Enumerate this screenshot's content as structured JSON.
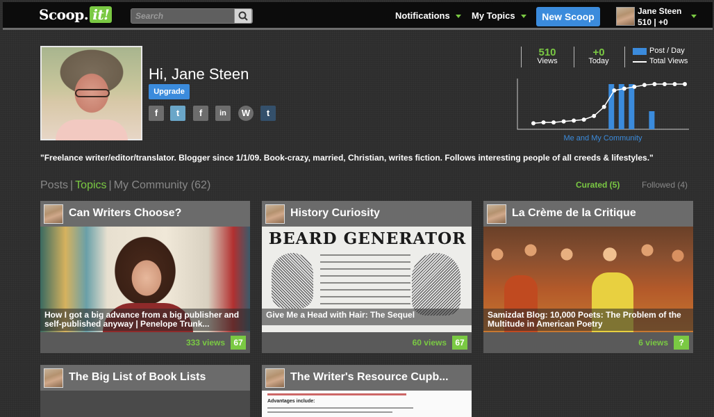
{
  "topbar": {
    "logo_main": "Scoop.",
    "logo_it": "it!",
    "search_placeholder": "Search",
    "notifications": "Notifications",
    "my_topics": "My Topics",
    "new_scoop": "New Scoop",
    "user_name": "Jane Steen",
    "user_stats": "510 | +0"
  },
  "profile": {
    "greeting": "Hi, Jane Steen",
    "upgrade": "Upgrade",
    "social": [
      {
        "name": "facebook",
        "glyph": "f",
        "color": "#6d6d6d"
      },
      {
        "name": "twitter",
        "glyph": "t",
        "color": "#6aa6c8"
      },
      {
        "name": "facebook-page",
        "glyph": "f",
        "color": "#6d6d6d"
      },
      {
        "name": "linkedin",
        "glyph": "in",
        "color": "#6d6d6d"
      },
      {
        "name": "wordpress",
        "glyph": "W",
        "color": "#6d6d6d"
      },
      {
        "name": "tumblr",
        "glyph": "t",
        "color": "#34506b"
      }
    ],
    "bio": "\"Freelance writer/editor/translator. Blogger since 1/1/09. Book-crazy, married, Christian, writes fiction. Follows interesting people of all creeds & lifestyles.\""
  },
  "stats": {
    "views_num": "510",
    "views_label": "Views",
    "today_num": "+0",
    "today_label": "Today",
    "legend_post": "Post / Day",
    "legend_views": "Total Views",
    "caption": "Me and My Community"
  },
  "chart_data": {
    "type": "line",
    "series": [
      {
        "name": "Post / Day",
        "kind": "bar",
        "values": [
          0,
          0,
          0,
          0,
          0,
          0,
          0,
          0,
          5,
          5,
          5,
          0,
          2,
          0,
          0,
          0
        ]
      },
      {
        "name": "Total Views",
        "kind": "line",
        "values": [
          2,
          3,
          3,
          4,
          5,
          6,
          10,
          20,
          38,
          40,
          42,
          44,
          45,
          45,
          45,
          45
        ]
      }
    ],
    "colors": {
      "bars": "#3b8bdc",
      "line": "#ffffff"
    }
  },
  "tabs": {
    "posts": "Posts",
    "topics": "Topics",
    "community": "My Community (62)",
    "curated": "Curated (5)",
    "followed": "Followed (4)"
  },
  "cards": [
    {
      "title": "Can Writers Choose?",
      "caption": "How I got a big advance from a big publisher and self-published anyway | Penelope Trunk...",
      "views": "333 views",
      "badge": "67"
    },
    {
      "title": "History Curiosity",
      "caption": "Give Me a Head with Hair: The Sequel",
      "views": "60 views",
      "badge": "67",
      "image_text": "BEARD GENERATOR"
    },
    {
      "title": "La Crème de la Critique",
      "caption": "Samizdat Blog: 10,000 Poets: The Problem of the Multitude in American Poetry",
      "views": "6 views",
      "badge": "?"
    },
    {
      "title": "The Big List of Book Lists"
    },
    {
      "title": "The Writer's Resource Cupb...",
      "image_text": "Advantages include:"
    }
  ],
  "colors": {
    "accent_green": "#7ac943",
    "accent_blue": "#3b8bdc"
  }
}
